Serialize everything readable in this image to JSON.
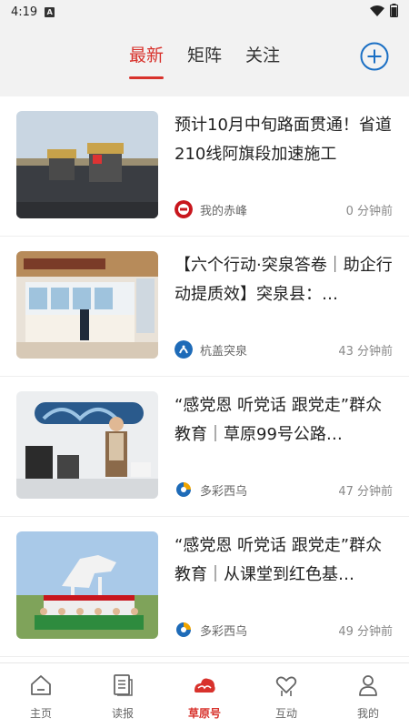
{
  "status": {
    "time": "4:19"
  },
  "tabs": [
    {
      "label": "最新",
      "active": true
    },
    {
      "label": "矩阵",
      "active": false
    },
    {
      "label": "关注",
      "active": false
    }
  ],
  "feed": [
    {
      "title": "预计10月中旬路面贯通！省道210线阿旗段加速施工",
      "source": "我的赤峰",
      "time": "0 分钟前"
    },
    {
      "title": "【六个行动·突泉答卷｜助企行动提质效】突泉县：…",
      "source": "杭盖突泉",
      "time": "43 分钟前"
    },
    {
      "title": "“感党恩 听党话 跟党走”群众教育｜草原99号公路…",
      "source": "多彩西乌",
      "time": "47 分钟前"
    },
    {
      "title": "“感党恩 听党话 跟党走”群众教育｜从课堂到红色基…",
      "source": "多彩西乌",
      "time": "49 分钟前"
    }
  ],
  "nav": [
    {
      "label": "主页",
      "icon": "home-icon"
    },
    {
      "label": "读报",
      "icon": "newspaper-icon"
    },
    {
      "label": "草原号",
      "icon": "cloud-icon",
      "active": true
    },
    {
      "label": "互动",
      "icon": "heart-hands-icon"
    },
    {
      "label": "我的",
      "icon": "person-icon"
    }
  ],
  "colors": {
    "accent": "#d8322c",
    "header_bg": "#f2f2f2",
    "add_button": "#1a6fc4"
  }
}
